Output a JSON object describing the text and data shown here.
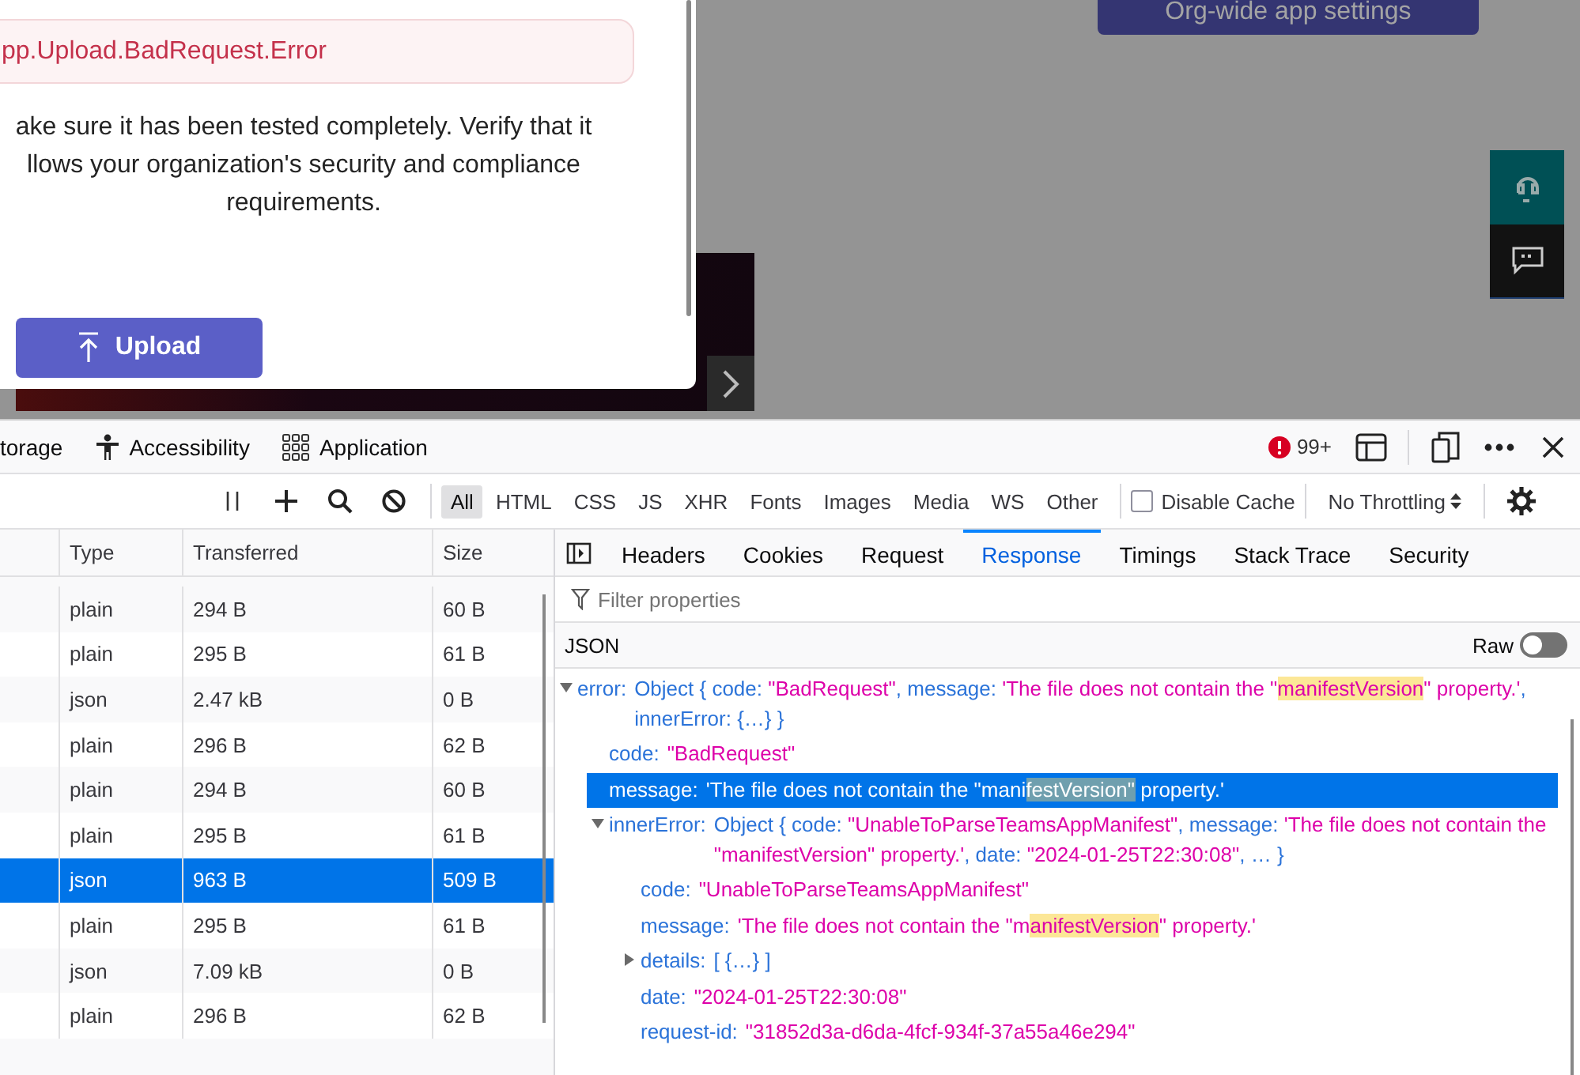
{
  "page": {
    "settings_button": "Org-wide app settings"
  },
  "dialog": {
    "error": "pp.Upload.BadRequest.Error",
    "note_lines": [
      "ake sure it has been tested completely. Verify that it",
      "llows your organization's security and compliance",
      "requirements."
    ],
    "upload_button": "Upload"
  },
  "devtools": {
    "panel_tabs": [
      {
        "label": "torage",
        "kind": "plain",
        "selected": false
      },
      {
        "label": "Accessibility",
        "kind": "accessibility",
        "selected": false
      },
      {
        "label": "Application",
        "kind": "application",
        "selected": false
      }
    ],
    "error_count": "99+",
    "toolbar": {
      "filters": [
        {
          "label": "All",
          "selected": true
        },
        {
          "label": "HTML",
          "selected": false
        },
        {
          "label": "CSS",
          "selected": false
        },
        {
          "label": "JS",
          "selected": false
        },
        {
          "label": "XHR",
          "selected": false
        },
        {
          "label": "Fonts",
          "selected": false
        },
        {
          "label": "Images",
          "selected": false
        },
        {
          "label": "Media",
          "selected": false
        },
        {
          "label": "WS",
          "selected": false
        },
        {
          "label": "Other",
          "selected": false
        }
      ],
      "disable_cache": {
        "label": "Disable Cache",
        "checked": false
      },
      "throttling": "No Throttling"
    },
    "requests": {
      "columns": [
        "Type",
        "Transferred",
        "Size"
      ],
      "rows": [
        {
          "type": "plain",
          "transferred": "294 B",
          "size": "60 B",
          "selected": false
        },
        {
          "type": "plain",
          "transferred": "295 B",
          "size": "61 B",
          "selected": false
        },
        {
          "type": "json",
          "transferred": "2.47 kB",
          "size": "0 B",
          "selected": false
        },
        {
          "type": "plain",
          "transferred": "296 B",
          "size": "62 B",
          "selected": false
        },
        {
          "type": "plain",
          "transferred": "294 B",
          "size": "60 B",
          "selected": false
        },
        {
          "type": "plain",
          "transferred": "295 B",
          "size": "61 B",
          "selected": false
        },
        {
          "type": "json",
          "transferred": "963 B",
          "size": "509 B",
          "selected": true
        },
        {
          "type": "plain",
          "transferred": "295 B",
          "size": "61 B",
          "selected": false
        },
        {
          "type": "json",
          "transferred": "7.09 kB",
          "size": "0 B",
          "selected": false
        },
        {
          "type": "plain",
          "transferred": "296 B",
          "size": "62 B",
          "selected": false
        }
      ]
    },
    "details": {
      "tabs": [
        {
          "label": "Headers",
          "selected": false
        },
        {
          "label": "Cookies",
          "selected": false
        },
        {
          "label": "Request",
          "selected": false
        },
        {
          "label": "Response",
          "selected": true
        },
        {
          "label": "Timings",
          "selected": false
        },
        {
          "label": "Stack Trace",
          "selected": false
        },
        {
          "label": "Security",
          "selected": false
        }
      ],
      "filter_placeholder": "Filter properties",
      "json_label": "JSON",
      "raw": {
        "label": "Raw",
        "on": false
      },
      "tree": [
        {
          "key": "error:",
          "expanded": true,
          "selected": false,
          "value": [
            {
              "text": "Object { code: ",
              "kind": "key"
            },
            {
              "text": "\"BadRequest\"",
              "kind": "string"
            },
            {
              "text": ", message: ",
              "kind": "key"
            },
            {
              "text": "'The file does not contain the \"",
              "kind": "string"
            },
            {
              "text": "manifestVersion",
              "kind": "string",
              "highlighted": true
            },
            {
              "text": "\" property.'",
              "kind": "string"
            },
            {
              "text": ", innerError: {…} }",
              "kind": "key"
            }
          ],
          "children": [
            {
              "key": "code:",
              "selected": false,
              "value": [
                {
                  "text": "\"BadRequest\"",
                  "kind": "string"
                }
              ]
            },
            {
              "key": "message:",
              "selected": true,
              "value": [
                {
                  "text": "'The file does not contain the \"mani",
                  "kind": "string"
                },
                {
                  "text": "festVersion\"",
                  "kind": "string",
                  "highlighted": true
                },
                {
                  "text": " property.'",
                  "kind": "string"
                }
              ]
            },
            {
              "key": "innerError:",
              "expanded": true,
              "selected": false,
              "value": [
                {
                  "text": "Object { code: ",
                  "kind": "key"
                },
                {
                  "text": "\"UnableToParseTeamsAppManifest\"",
                  "kind": "string"
                },
                {
                  "text": ", message: ",
                  "kind": "key"
                },
                {
                  "text": "'The file does not contain the \"manifestVersion\" property.'",
                  "kind": "string"
                },
                {
                  "text": ", date: ",
                  "kind": "key"
                },
                {
                  "text": "\"2024-01-25T22:30:08\"",
                  "kind": "string"
                },
                {
                  "text": ", … }",
                  "kind": "key"
                }
              ],
              "children": [
                {
                  "key": "code:",
                  "selected": false,
                  "value": [
                    {
                      "text": "\"UnableToParseTeamsAppManifest\"",
                      "kind": "string"
                    }
                  ]
                },
                {
                  "key": "message:",
                  "selected": false,
                  "value": [
                    {
                      "text": "'The file does not contain the \"m",
                      "kind": "string"
                    },
                    {
                      "text": "anifestVersion",
                      "kind": "string",
                      "highlighted": true
                    },
                    {
                      "text": "\" property.'",
                      "kind": "string"
                    }
                  ]
                },
                {
                  "key": "details:",
                  "expanded": false,
                  "selected": false,
                  "value": [
                    {
                      "text": "[ {…} ]",
                      "kind": "key"
                    }
                  ]
                },
                {
                  "key": "date:",
                  "selected": false,
                  "value": [
                    {
                      "text": "\"2024-01-25T22:30:08\"",
                      "kind": "string"
                    }
                  ]
                },
                {
                  "key": "request-id:",
                  "selected": false,
                  "value": [
                    {
                      "text": "\"31852d3a-d6da-4fcf-934f-37a55a46e294\"",
                      "kind": "string"
                    }
                  ]
                }
              ]
            }
          ]
        }
      ]
    }
  }
}
